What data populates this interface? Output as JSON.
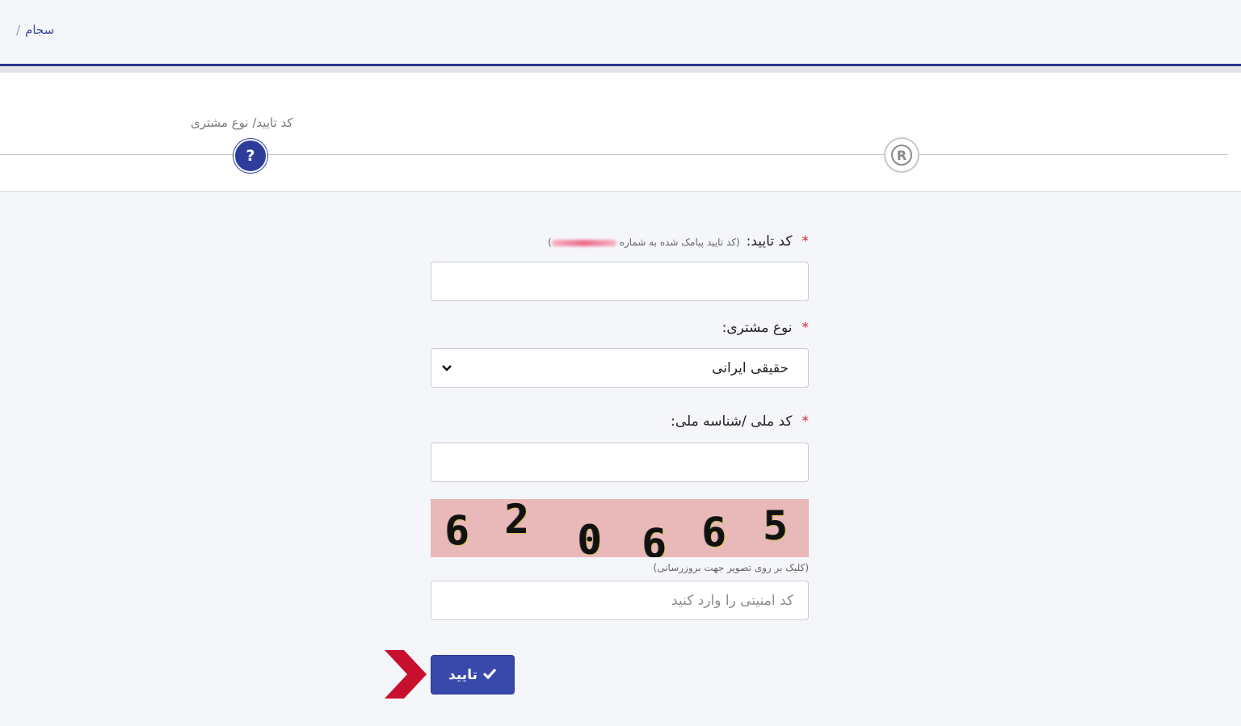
{
  "breadcrumb": {
    "item": "سجام",
    "separator": "/"
  },
  "stepper": {
    "active_step_label": "کد تایید/ نوع مشتری",
    "active_step_icon": "question-icon",
    "active_step_glyph": "?",
    "next_step_icon": "registered-icon",
    "next_step_glyph": "®"
  },
  "form": {
    "verification": {
      "label": "کد تایید:",
      "required_mark": "*",
      "hint_open": "(",
      "hint": "کد تایید پیامک شده به شماره",
      "hint_close": ")",
      "value": ""
    },
    "customer_type": {
      "label": "نوع مشتری:",
      "required_mark": "*",
      "selected": "حقیقی ایرانی"
    },
    "national_id": {
      "label": "کد ملی /شناسه ملی:",
      "required_mark": "*",
      "value": ""
    },
    "captcha": {
      "digits": [
        "6",
        "2",
        "0",
        "6",
        "6",
        "5"
      ],
      "refresh_note": "(کلیک بر روی تصویر جهت بروزرسانی)",
      "placeholder": "کد امنیتی را وارد کنید"
    },
    "submit": {
      "label": "تایید",
      "icon": "check-icon"
    }
  },
  "colors": {
    "primary": "#3949ab",
    "header_border": "#2b3990",
    "required": "#d9232d",
    "captcha_bg": "#e9b8b8",
    "arrow": "#c8102e"
  }
}
